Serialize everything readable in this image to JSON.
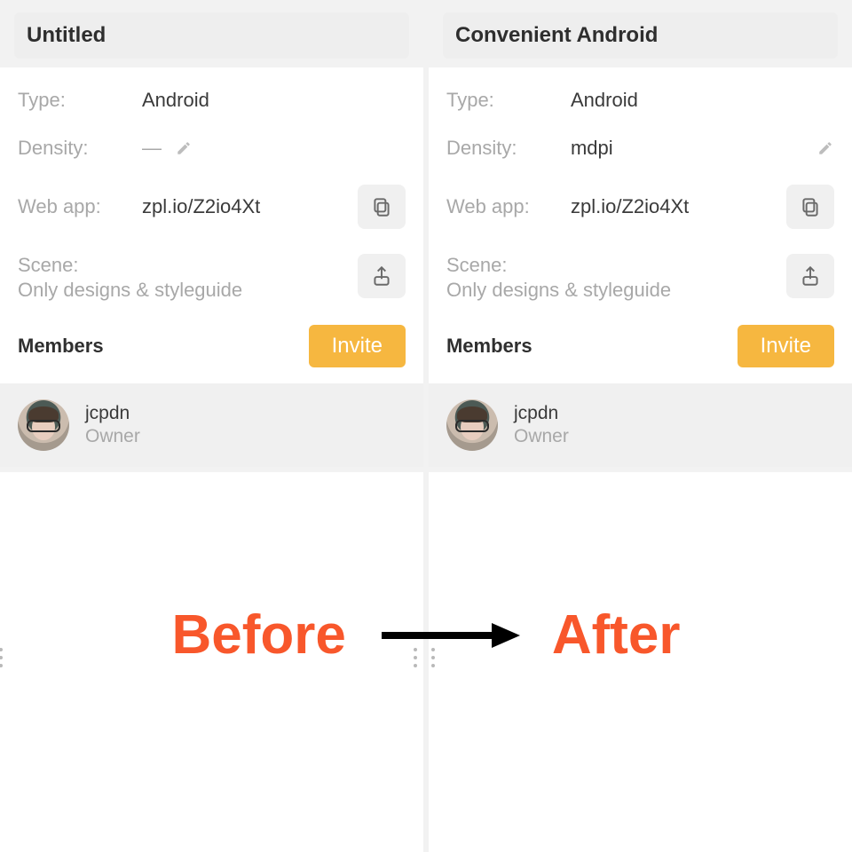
{
  "panels": {
    "left": {
      "title": "Untitled",
      "type_label": "Type:",
      "type_value": "Android",
      "density_label": "Density:",
      "density_value": "—",
      "density_is_placeholder": true,
      "webapp_label": "Web app:",
      "webapp_value": "zpl.io/Z2io4Xt",
      "scene_label": "Scene:",
      "scene_value": "Only designs & styleguide",
      "members_heading": "Members",
      "invite_label": "Invite",
      "member": {
        "name": "jcpdn",
        "role": "Owner"
      }
    },
    "right": {
      "title": "Convenient Android",
      "type_label": "Type:",
      "type_value": "Android",
      "density_label": "Density:",
      "density_value": "mdpi",
      "density_is_placeholder": false,
      "webapp_label": "Web app:",
      "webapp_value": "zpl.io/Z2io4Xt",
      "scene_label": "Scene:",
      "scene_value": "Only designs & styleguide",
      "members_heading": "Members",
      "invite_label": "Invite",
      "member": {
        "name": "jcpdn",
        "role": "Owner"
      }
    }
  },
  "annotation": {
    "before": "Before",
    "after": "After"
  }
}
